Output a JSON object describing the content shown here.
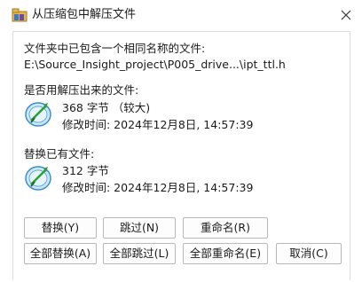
{
  "window": {
    "title": "从压缩包中解压文件",
    "title_icon": "archive-icon",
    "close_icon": "close-icon"
  },
  "message": {
    "line1": "文件夹中已包含一个相同名称的文件:",
    "path": "E:\\Source_Insight_project\\P005_drive...\\ipt_ttl.h"
  },
  "new_file": {
    "heading": "是否用解压出来的文件:",
    "icon": "file-type-icon",
    "size": "368 字节  （较大)",
    "modified": "修改时间: 2024年12月8日, 14:57:39"
  },
  "existing_file": {
    "heading": "替换已有文件:",
    "icon": "file-type-icon",
    "size": "312 字节",
    "modified": "修改时间: 2024年12月8日, 14:57:39"
  },
  "buttons": {
    "replace": "替换(Y)",
    "skip": "跳过(N)",
    "rename": "重命名(R)",
    "replace_all": "全部替换(A)",
    "skip_all": "全部跳过(L)",
    "rename_all": "全部重命名(E)",
    "cancel": "取消(C)"
  }
}
